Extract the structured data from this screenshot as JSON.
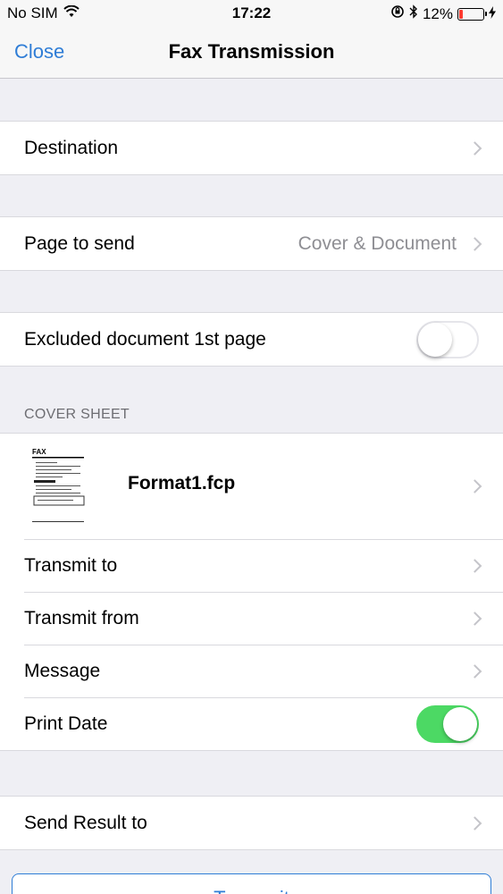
{
  "status_bar": {
    "carrier": "No SIM",
    "time": "17:22",
    "battery_percent": "12%",
    "icons": [
      "wifi-icon",
      "orientation-lock-icon",
      "bluetooth-icon",
      "battery-icon",
      "charging-icon"
    ]
  },
  "nav": {
    "close_label": "Close",
    "title": "Fax Transmission"
  },
  "destination": {
    "label": "Destination"
  },
  "page_to_send": {
    "label": "Page to send",
    "value": "Cover & Document"
  },
  "excluded": {
    "label": "Excluded document 1st page",
    "on": false
  },
  "cover_sheet": {
    "header": "COVER SHEET",
    "format_name": "Format1.fcp",
    "thumb_text": "FAX",
    "rows": [
      {
        "label": "Transmit to"
      },
      {
        "label": "Transmit from"
      },
      {
        "label": "Message"
      }
    ],
    "print_date": {
      "label": "Print Date",
      "on": true
    }
  },
  "send_result": {
    "label": "Send Result to"
  },
  "transmit_button": {
    "label": "Transmit"
  },
  "colors": {
    "accent": "#2f7dd6",
    "toggle_on": "#4cd964",
    "background": "#efeff4"
  }
}
